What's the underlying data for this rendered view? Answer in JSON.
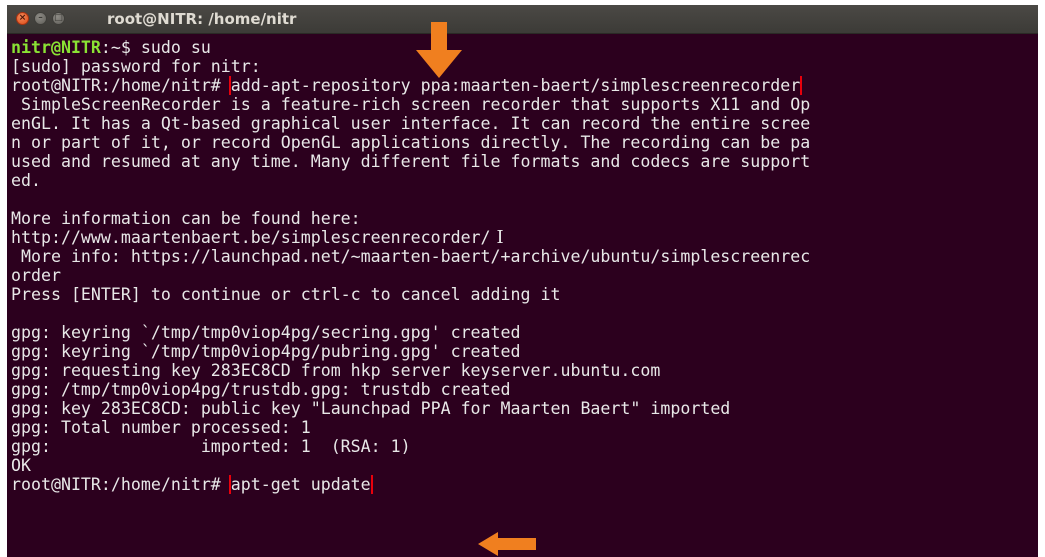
{
  "window": {
    "title": "root@NITR: /home/nitr",
    "buttons": {
      "close": "×",
      "minimize": "–",
      "maximize": "□"
    }
  },
  "terminal": {
    "prompt_user": "nitr@NITR",
    "prompt_user_suffix": ":~$ sudo su",
    "line2": "[sudo] password for nitr:",
    "root_prompt": "root@NITR:/home/nitr#",
    "cmd1": "add-apt-repository ppa:maarten-baert/simplescreenrecorder",
    "desc1": " SimpleScreenRecorder is a feature-rich screen recorder that supports X11 and Op",
    "desc2": "enGL. It has a Qt-based graphical user interface. It can record the entire scree",
    "desc3": "n or part of it, or record OpenGL applications directly. The recording can be pa",
    "desc4": "used and resumed at any time. Many different file formats and codecs are support",
    "desc5": "ed.",
    "more1": "More information can be found here:",
    "more2": "http://www.maartenbaert.be/simplescreenrecorder/",
    "text_cursor": "I",
    "more3": " More info: https://launchpad.net/~maarten-baert/+archive/ubuntu/simplescreenrec",
    "more4": "order",
    "press": "Press [ENTER] to continue or ctrl-c to cancel adding it",
    "gpg1": "gpg: keyring `/tmp/tmp0viop4pg/secring.gpg' created",
    "gpg2": "gpg: keyring `/tmp/tmp0viop4pg/pubring.gpg' created",
    "gpg3": "gpg: requesting key 283EC8CD from hkp server keyserver.ubuntu.com",
    "gpg4": "gpg: /tmp/tmp0viop4pg/trustdb.gpg: trustdb created",
    "gpg5": "gpg: key 283EC8CD: public key \"Launchpad PPA for Maarten Baert\" imported",
    "gpg6": "gpg: Total number processed: 1",
    "gpg7": "gpg:               imported: 1  (RSA: 1)",
    "ok": "OK",
    "root_prompt2": "root@NITR:/home/nitr#",
    "cmd2": "apt-get update"
  },
  "annotations": {
    "arrow_color": "#f07f1f",
    "highlight_color": "#e8000c"
  }
}
